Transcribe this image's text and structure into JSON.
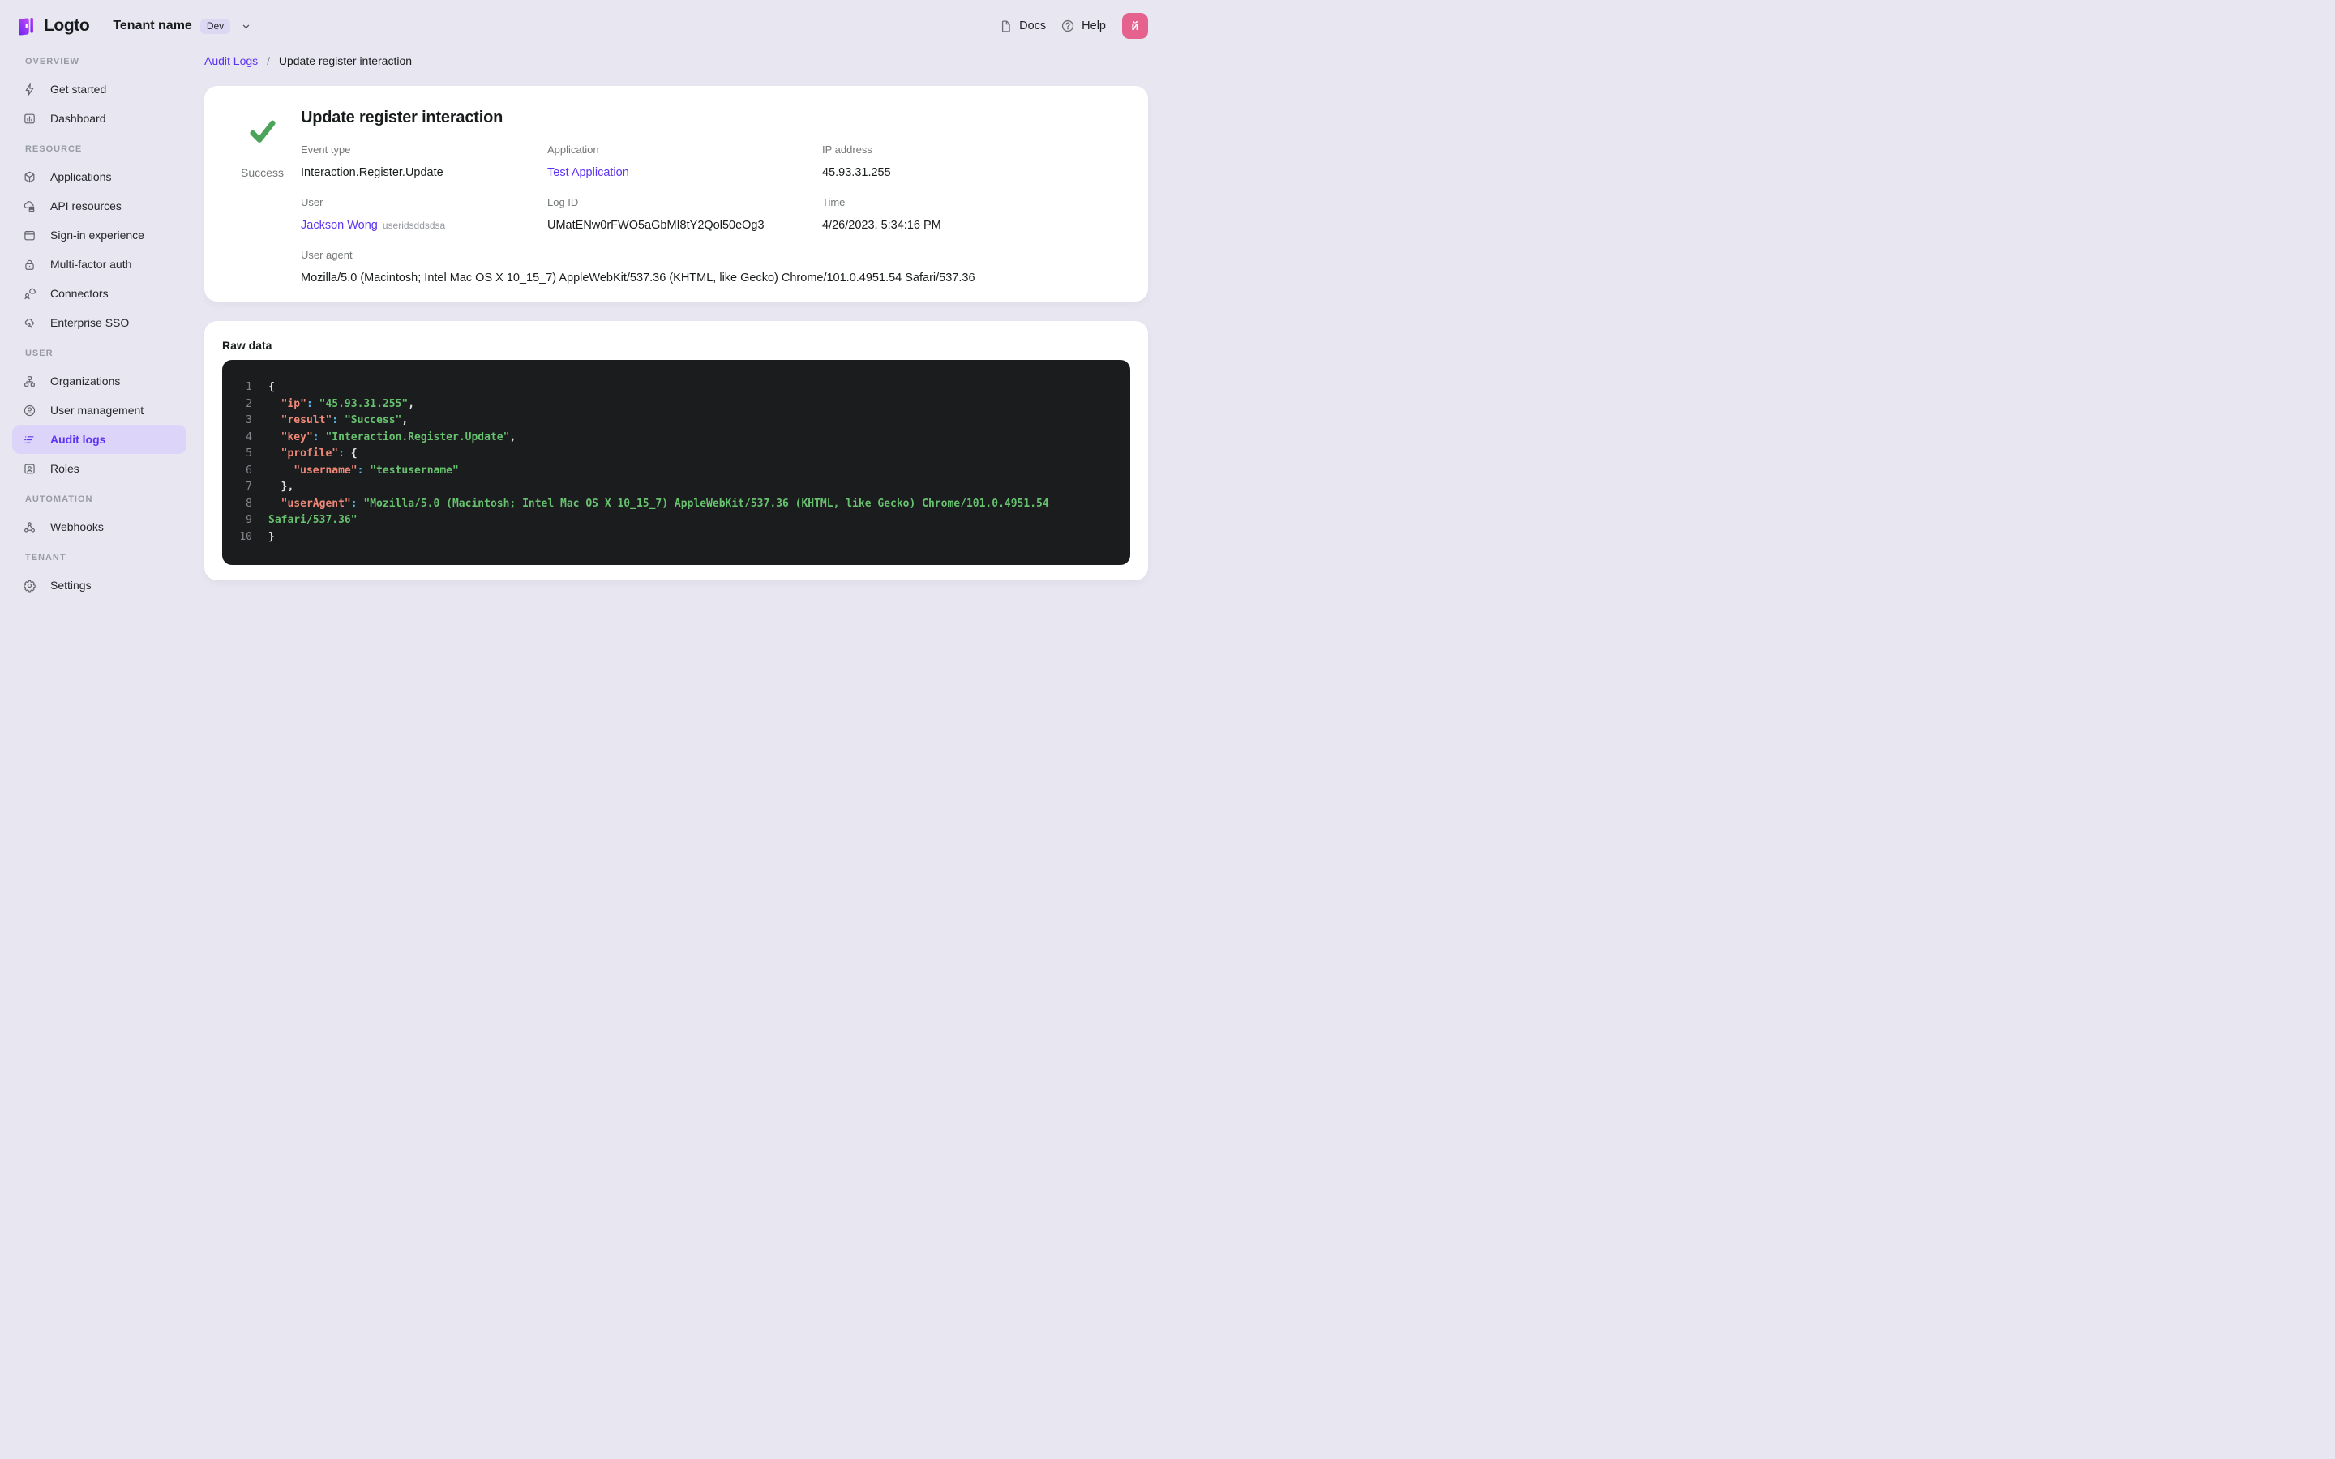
{
  "colors": {
    "accent": "#5d34f2",
    "page_bg": "#e8e6f1",
    "success_green": "#4ca35a",
    "avatar_bg": "#e4628d",
    "active_item_bg": "#ddd4fa",
    "code_bg": "#1a1c1e",
    "code_key": "#f08878",
    "code_colon": "#58b2e6",
    "code_string": "#67c16f"
  },
  "topbar": {
    "logo_text": "Logto",
    "tenant_name": "Tenant name",
    "env_badge": "Dev",
    "docs_label": "Docs",
    "help_label": "Help",
    "avatar_initial": "й"
  },
  "sidebar": {
    "sections": [
      {
        "label": "OVERVIEW",
        "items": [
          {
            "icon": "lightning-icon",
            "label": "Get started"
          },
          {
            "icon": "dashboard-icon",
            "label": "Dashboard"
          }
        ]
      },
      {
        "label": "RESOURCE",
        "items": [
          {
            "icon": "cube-icon",
            "label": "Applications"
          },
          {
            "icon": "cloud-stack-icon",
            "label": "API resources"
          },
          {
            "icon": "browser-icon",
            "label": "Sign-in experience"
          },
          {
            "icon": "lock-icon",
            "label": "Multi-factor auth"
          },
          {
            "icon": "connector-icon",
            "label": "Connectors"
          },
          {
            "icon": "cloud-key-icon",
            "label": "Enterprise SSO"
          }
        ]
      },
      {
        "label": "USER",
        "items": [
          {
            "icon": "org-chart-icon",
            "label": "Organizations"
          },
          {
            "icon": "user-circle-icon",
            "label": "User management"
          },
          {
            "icon": "list-icon",
            "label": "Audit logs",
            "active": true
          },
          {
            "icon": "id-card-icon",
            "label": "Roles"
          }
        ]
      },
      {
        "label": "AUTOMATION",
        "items": [
          {
            "icon": "webhook-icon",
            "label": "Webhooks"
          }
        ]
      },
      {
        "label": "TENANT",
        "items": [
          {
            "icon": "gear-icon",
            "label": "Settings"
          }
        ]
      }
    ]
  },
  "breadcrumb": {
    "parent": "Audit Logs",
    "separator": "/",
    "current": "Update register interaction"
  },
  "detail": {
    "title": "Update register interaction",
    "status": "Success",
    "fields": [
      {
        "label": "Event type",
        "value": "Interaction.Register.Update",
        "type": "text"
      },
      {
        "label": "Application",
        "value": "Test Application",
        "type": "link"
      },
      {
        "label": "IP address",
        "value": "45.93.31.255",
        "type": "text"
      },
      {
        "label": "User",
        "value": "Jackson Wong",
        "type": "link",
        "suffix": "useridsddsdsa"
      },
      {
        "label": "Log ID",
        "value": "UMatENw0rFWO5aGbMI8tY2Qol50eOg3",
        "type": "text"
      },
      {
        "label": "Time",
        "value": "4/26/2023, 5:34:16 PM",
        "type": "text"
      },
      {
        "label": "User agent",
        "value": "Mozilla/5.0 (Macintosh; Intel Mac OS X 10_15_7) AppleWebKit/537.36 (KHTML, like Gecko) Chrome/101.0.4951.54 Safari/537.36",
        "type": "text",
        "span": true
      }
    ]
  },
  "raw": {
    "title": "Raw data",
    "lines": [
      {
        "n": "1",
        "seg": [
          [
            "b",
            "{"
          ]
        ]
      },
      {
        "n": "2",
        "seg": [
          [
            "p",
            "  "
          ],
          [
            "k",
            "\"ip\""
          ],
          [
            "c",
            ":"
          ],
          [
            "p",
            " "
          ],
          [
            "s",
            "\"45.93.31.255\""
          ],
          [
            "b",
            ","
          ]
        ]
      },
      {
        "n": "3",
        "seg": [
          [
            "p",
            "  "
          ],
          [
            "k",
            "\"result\""
          ],
          [
            "c",
            ":"
          ],
          [
            "p",
            " "
          ],
          [
            "s",
            "\"Success\""
          ],
          [
            "b",
            ","
          ]
        ]
      },
      {
        "n": "4",
        "seg": [
          [
            "p",
            "  "
          ],
          [
            "k",
            "\"key\""
          ],
          [
            "c",
            ":"
          ],
          [
            "p",
            " "
          ],
          [
            "s",
            "\"Interaction.Register.Update\""
          ],
          [
            "b",
            ","
          ]
        ]
      },
      {
        "n": "5",
        "seg": [
          [
            "p",
            "  "
          ],
          [
            "k",
            "\"profile\""
          ],
          [
            "c",
            ":"
          ],
          [
            "p",
            " "
          ],
          [
            "b",
            "{"
          ]
        ]
      },
      {
        "n": "6",
        "seg": [
          [
            "p",
            "    "
          ],
          [
            "k",
            "\"username\""
          ],
          [
            "c",
            ":"
          ],
          [
            "p",
            " "
          ],
          [
            "s",
            "\"testusername\""
          ]
        ]
      },
      {
        "n": "7",
        "seg": [
          [
            "p",
            "  "
          ],
          [
            "b",
            "},"
          ]
        ]
      },
      {
        "n": "8",
        "seg": [
          [
            "p",
            "  "
          ],
          [
            "k",
            "\"userAgent\""
          ],
          [
            "c",
            ":"
          ],
          [
            "p",
            " "
          ],
          [
            "s",
            "\"Mozilla/5.0 (Macintosh; Intel Mac OS X 10_15_7) AppleWebKit/537.36 (KHTML, like Gecko) Chrome/101.0.4951.54"
          ]
        ]
      },
      {
        "n": "9",
        "seg": [
          [
            "s",
            "Safari/537.36\""
          ]
        ]
      },
      {
        "n": "10",
        "seg": [
          [
            "b",
            "}"
          ]
        ]
      }
    ]
  }
}
